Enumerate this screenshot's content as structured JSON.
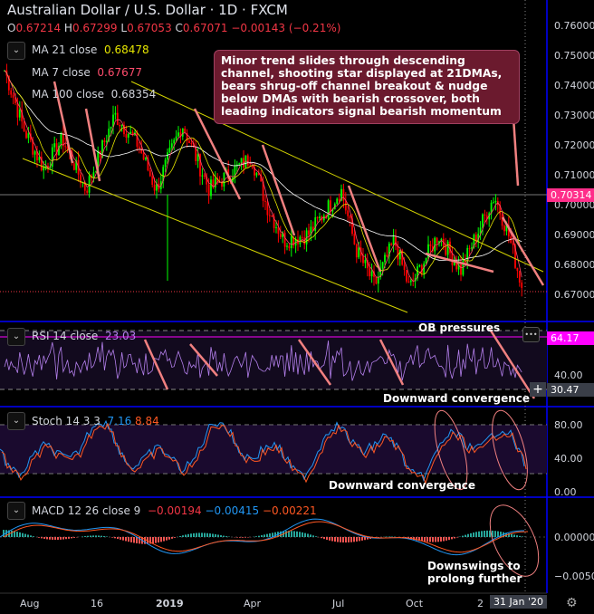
{
  "header": {
    "title": "Australian Dollar / U.S. Dollar · 1D · FXCM",
    "ohlc": {
      "o_label": "O",
      "o": "0.67214",
      "h_label": "H",
      "h": "0.67299",
      "l_label": "L",
      "l": "0.67053",
      "c_label": "C",
      "c": "0.67071",
      "change": "−0.00143 (−0.21%)"
    }
  },
  "legend": {
    "ma21_label": "MA 21 close",
    "ma21": "0.68478",
    "ma7_label": "MA 7 close",
    "ma7": "0.67677",
    "ma100_label": "MA 100 close",
    "ma100": "0.68354"
  },
  "note": "Minor trend slides through descending channel, shooting star displayed at 21DMAs, bears shrug-off channel breakout & nudge below DMAs with bearish crossover, both leading indicators signal bearish momentum",
  "price_axis": [
    "0.76000",
    "0.75000",
    "0.74000",
    "0.73000",
    "0.72000",
    "0.71000",
    "0.70000",
    "0.69000",
    "0.68000",
    "0.67000"
  ],
  "price_tag": "0.70314",
  "rsi": {
    "label": "RSI 14 close",
    "value": "23.03",
    "tag": "64.17",
    "axis": "40.00",
    "cursor_tag": "30.47",
    "ann_top": "OB pressures",
    "ann_bottom": "Downward convergence",
    "menu": "•••"
  },
  "stoch": {
    "label": "Stoch 14 3 3",
    "k": "7.16",
    "d": "8.84",
    "axis": [
      "80.00",
      "40.00",
      "0.00"
    ],
    "ann": "Downward convergence"
  },
  "macd": {
    "label": "MACD 12 26 close 9",
    "v1": "−0.00194",
    "v2": "−0.00415",
    "v3": "−0.00221",
    "axis": [
      "0.00000",
      "−0.00500"
    ],
    "ann1": "Downswings to",
    "ann2": "prolong further"
  },
  "time_axis": [
    "Aug",
    "16",
    "2019",
    "Apr",
    "Jul",
    "Oct",
    "2",
    "31 Jan '20"
  ],
  "colors": {
    "bull": "#00ff00",
    "bear": "#ff0000",
    "ma21": "#e6e600",
    "ma7": "#ff4d6d",
    "ma100": "#ffffff",
    "channel": "#d4d400",
    "arrow": "#f08080",
    "rsi": "#b37feb",
    "stoch_k": "#2196f3",
    "stoch_d": "#ff5722",
    "pane_sep": "#0000ff"
  },
  "chart_data": {
    "type": "candlestick",
    "symbol": "AUDUSD",
    "interval": "1D",
    "ylim": [
      0.665,
      0.762
    ],
    "approx_close": [
      {
        "x": "2018-07-25",
        "y": 0.745
      },
      {
        "x": "2018-08-15",
        "y": 0.725
      },
      {
        "x": "2018-09-05",
        "y": 0.712
      },
      {
        "x": "2018-09-25",
        "y": 0.722
      },
      {
        "x": "2018-10-20",
        "y": 0.705
      },
      {
        "x": "2018-11-20",
        "y": 0.73
      },
      {
        "x": "2018-12-15",
        "y": 0.72
      },
      {
        "x": "2019-01-03",
        "y": 0.705
      },
      {
        "x": "2019-01-31",
        "y": 0.727
      },
      {
        "x": "2019-03-01",
        "y": 0.705
      },
      {
        "x": "2019-04-15",
        "y": 0.716
      },
      {
        "x": "2019-05-01",
        "y": 0.7
      },
      {
        "x": "2019-05-20",
        "y": 0.688
      },
      {
        "x": "2019-06-15",
        "y": 0.69
      },
      {
        "x": "2019-07-20",
        "y": 0.705
      },
      {
        "x": "2019-08-05",
        "y": 0.685
      },
      {
        "x": "2019-08-25",
        "y": 0.673
      },
      {
        "x": "2019-09-15",
        "y": 0.688
      },
      {
        "x": "2019-10-01",
        "y": 0.672
      },
      {
        "x": "2019-11-01",
        "y": 0.69
      },
      {
        "x": "2019-11-25",
        "y": 0.678
      },
      {
        "x": "2019-12-12",
        "y": 0.69
      },
      {
        "x": "2019-12-31",
        "y": 0.703
      },
      {
        "x": "2020-01-15",
        "y": 0.69
      },
      {
        "x": "2020-01-31",
        "y": 0.6707
      }
    ],
    "moving_averages": [
      "MA 21",
      "MA 7",
      "MA 100"
    ],
    "indicators": [
      "RSI 14",
      "Stoch 14 3 3",
      "MACD 12 26 9"
    ]
  }
}
